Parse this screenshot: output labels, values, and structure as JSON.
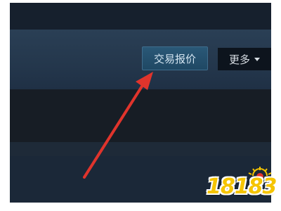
{
  "toolbar": {
    "trade_offer_label": "交易报价",
    "more_label": "更多"
  },
  "watermark": {
    "text": "18183"
  },
  "annotation": {
    "arrow_color": "#e0342c"
  },
  "colors": {
    "background": "#1b2838",
    "button_accent": "#2a5877"
  }
}
